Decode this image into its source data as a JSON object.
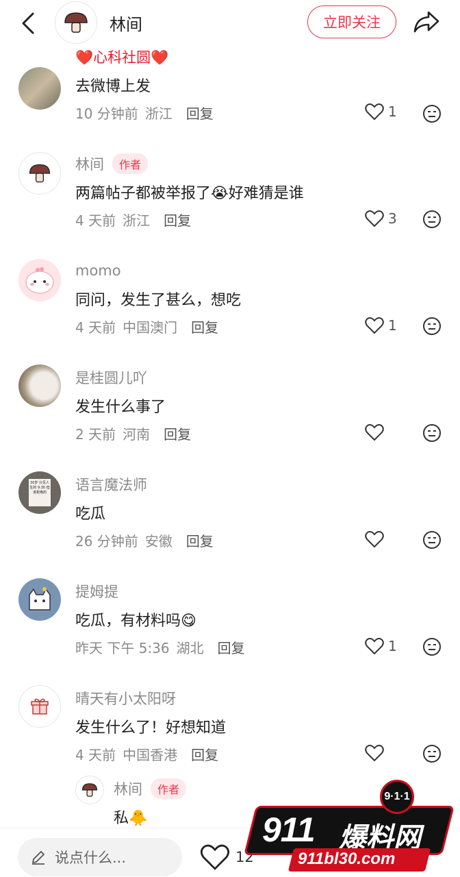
{
  "header": {
    "username": "林间",
    "follow_label": "立即关注"
  },
  "comments": [
    {
      "name_partial": "❤️心科社圆❤️",
      "text": "去微博上发",
      "time": "10 分钟前",
      "location": "浙江",
      "reply_label": "回复",
      "likes": "1",
      "is_author": false
    },
    {
      "name": "林间",
      "author_tag": "作者",
      "text": "两篇帖子都被举报了😭好难猜是谁",
      "time": "4 天前",
      "location": "浙江",
      "reply_label": "回复",
      "likes": "3",
      "is_author": true
    },
    {
      "name": "momo",
      "text": "同问，发生了甚么，想吃",
      "time": "4 天前",
      "location": "中国澳门",
      "reply_label": "回复",
      "likes": "1"
    },
    {
      "name": "是桂圆儿吖",
      "text": "发生什么事了",
      "time": "2 天前",
      "location": "河南",
      "reply_label": "回复",
      "likes": ""
    },
    {
      "name": "语言魔法师",
      "avatar_text": "30岁 只见人生的 9:30 但该拒绝的",
      "text": "吃瓜",
      "time": "26 分钟前",
      "location": "安徽",
      "reply_label": "回复",
      "likes": ""
    },
    {
      "name": "提姆提",
      "text": "吃瓜，有材料吗😋",
      "time": "昨天 下午 5:36",
      "location": "湖北",
      "reply_label": "回复",
      "likes": "1"
    },
    {
      "name": "晴天有小太阳呀",
      "text": "发生什么了！好想知道",
      "time": "4 天前",
      "location": "中国香港",
      "reply_label": "回复",
      "likes": ""
    }
  ],
  "sub_reply": {
    "name": "林间",
    "author_tag": "作者",
    "text": "私🐥"
  },
  "bottom_bar": {
    "input_placeholder": "说点什么...",
    "likes": "12"
  },
  "watermark": {
    "brand_number": "911",
    "brand_cn": "爆料网",
    "badge": "9·1·1",
    "url": "911bl30.com"
  },
  "colors": {
    "accent": "#e8374a",
    "muted": "#8a8a8a"
  }
}
